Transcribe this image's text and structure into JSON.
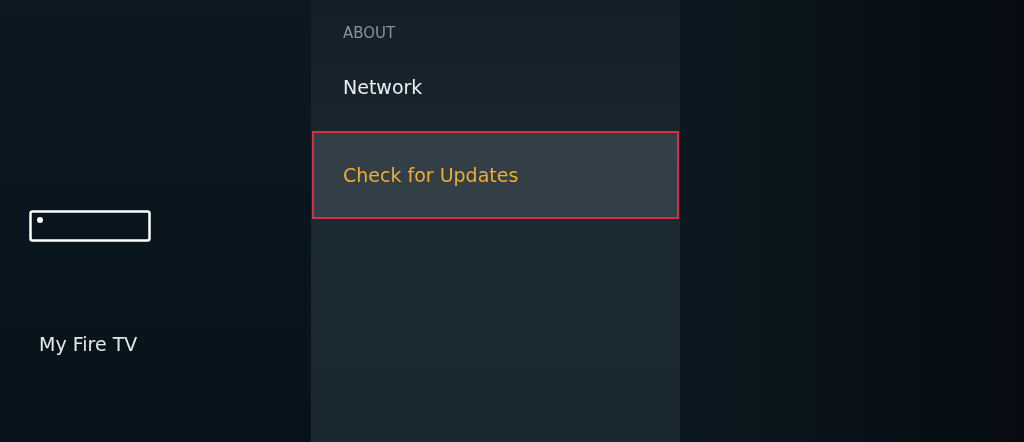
{
  "sidebar": {
    "title": "My Fire TV"
  },
  "menu": {
    "heading": "ABOUT",
    "items": [
      {
        "label": "Network",
        "selected": false
      },
      {
        "label": "Check for Updates",
        "selected": true
      }
    ]
  }
}
